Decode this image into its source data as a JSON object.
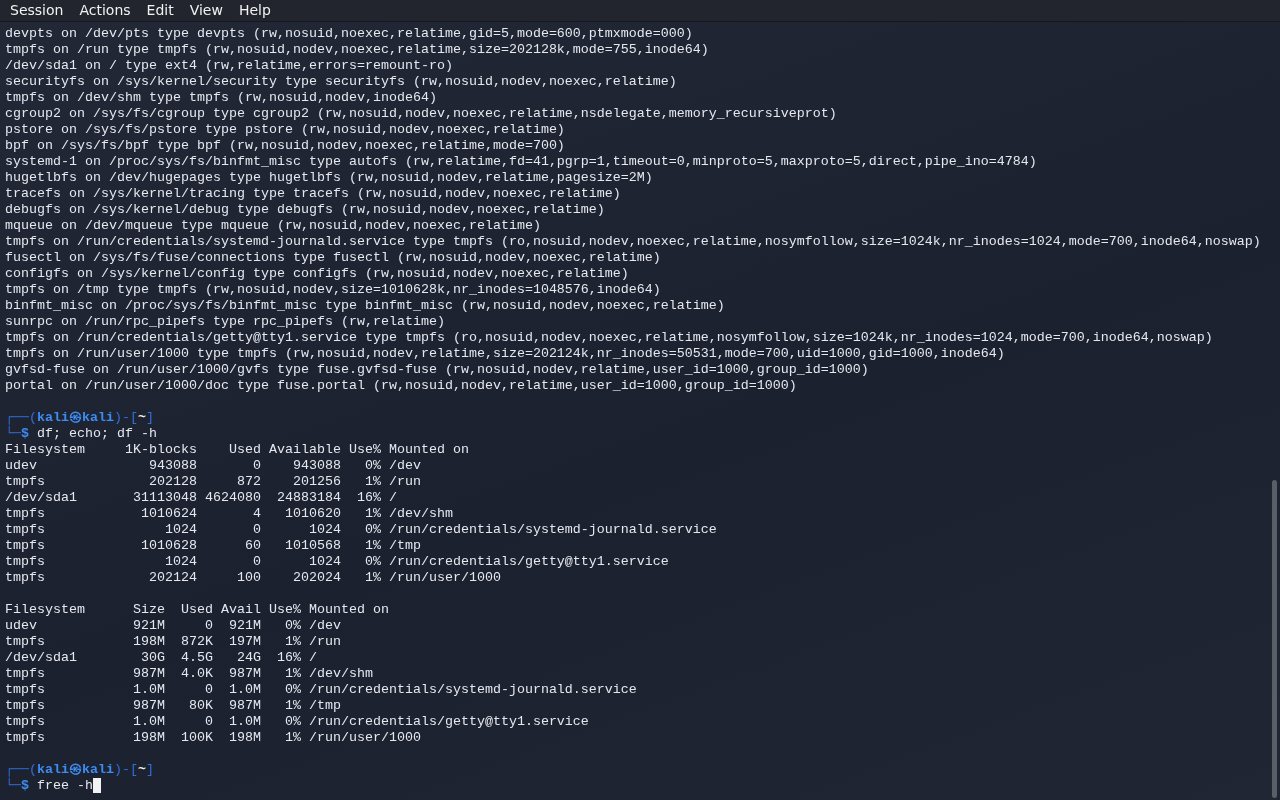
{
  "menu": [
    {
      "label": "Session"
    },
    {
      "label": "Actions"
    },
    {
      "label": "Edit"
    },
    {
      "label": "View"
    },
    {
      "label": "Help"
    }
  ],
  "lines": [
    {
      "kind": "output",
      "text": "devpts on /dev/pts type devpts (rw,nosuid,noexec,relatime,gid=5,mode=600,ptmxmode=000)"
    },
    {
      "kind": "output",
      "text": "tmpfs on /run type tmpfs (rw,nosuid,nodev,noexec,relatime,size=202128k,mode=755,inode64)"
    },
    {
      "kind": "output",
      "text": "/dev/sda1 on / type ext4 (rw,relatime,errors=remount-ro)"
    },
    {
      "kind": "output",
      "text": "securityfs on /sys/kernel/security type securityfs (rw,nosuid,nodev,noexec,relatime)"
    },
    {
      "kind": "output",
      "text": "tmpfs on /dev/shm type tmpfs (rw,nosuid,nodev,inode64)"
    },
    {
      "kind": "output",
      "text": "cgroup2 on /sys/fs/cgroup type cgroup2 (rw,nosuid,nodev,noexec,relatime,nsdelegate,memory_recursiveprot)"
    },
    {
      "kind": "output",
      "text": "pstore on /sys/fs/pstore type pstore (rw,nosuid,nodev,noexec,relatime)"
    },
    {
      "kind": "output",
      "text": "bpf on /sys/fs/bpf type bpf (rw,nosuid,nodev,noexec,relatime,mode=700)"
    },
    {
      "kind": "output",
      "text": "systemd-1 on /proc/sys/fs/binfmt_misc type autofs (rw,relatime,fd=41,pgrp=1,timeout=0,minproto=5,maxproto=5,direct,pipe_ino=4784)"
    },
    {
      "kind": "output",
      "text": "hugetlbfs on /dev/hugepages type hugetlbfs (rw,nosuid,nodev,relatime,pagesize=2M)"
    },
    {
      "kind": "output",
      "text": "tracefs on /sys/kernel/tracing type tracefs (rw,nosuid,nodev,noexec,relatime)"
    },
    {
      "kind": "output",
      "text": "debugfs on /sys/kernel/debug type debugfs (rw,nosuid,nodev,noexec,relatime)"
    },
    {
      "kind": "output",
      "text": "mqueue on /dev/mqueue type mqueue (rw,nosuid,nodev,noexec,relatime)"
    },
    {
      "kind": "output",
      "text": "tmpfs on /run/credentials/systemd-journald.service type tmpfs (ro,nosuid,nodev,noexec,relatime,nosymfollow,size=1024k,nr_inodes=1024,mode=700,inode64,noswap)"
    },
    {
      "kind": "output",
      "text": "fusectl on /sys/fs/fuse/connections type fusectl (rw,nosuid,nodev,noexec,relatime)"
    },
    {
      "kind": "output",
      "text": "configfs on /sys/kernel/config type configfs (rw,nosuid,nodev,noexec,relatime)"
    },
    {
      "kind": "output",
      "text": "tmpfs on /tmp type tmpfs (rw,nosuid,nodev,size=1010628k,nr_inodes=1048576,inode64)"
    },
    {
      "kind": "output",
      "text": "binfmt_misc on /proc/sys/fs/binfmt_misc type binfmt_misc (rw,nosuid,nodev,noexec,relatime)"
    },
    {
      "kind": "output",
      "text": "sunrpc on /run/rpc_pipefs type rpc_pipefs (rw,relatime)"
    },
    {
      "kind": "output",
      "text": "tmpfs on /run/credentials/getty@tty1.service type tmpfs (ro,nosuid,nodev,noexec,relatime,nosymfollow,size=1024k,nr_inodes=1024,mode=700,inode64,noswap)"
    },
    {
      "kind": "output",
      "text": "tmpfs on /run/user/1000 type tmpfs (rw,nosuid,nodev,relatime,size=202124k,nr_inodes=50531,mode=700,uid=1000,gid=1000,inode64)"
    },
    {
      "kind": "output",
      "text": "gvfsd-fuse on /run/user/1000/gvfs type fuse.gvfsd-fuse (rw,nosuid,nodev,relatime,user_id=1000,group_id=1000)"
    },
    {
      "kind": "output",
      "text": "portal on /run/user/1000/doc type fuse.portal (rw,nosuid,nodev,relatime,user_id=1000,group_id=1000)"
    },
    {
      "kind": "blank"
    },
    {
      "kind": "prompt",
      "corner_top": "┌──(",
      "user": "kali",
      "at": "㉿",
      "host": "kali",
      "mid": ")-[",
      "dir": "~",
      "end": "]",
      "corner_bottom": "└─",
      "symbol": "$",
      "command": "df; echo; df -h",
      "cursor": false
    },
    {
      "kind": "output",
      "text": "Filesystem     1K-blocks    Used Available Use% Mounted on"
    },
    {
      "kind": "output",
      "text": "udev              943088       0    943088   0% /dev"
    },
    {
      "kind": "output",
      "text": "tmpfs             202128     872    201256   1% /run"
    },
    {
      "kind": "output",
      "text": "/dev/sda1       31113048 4624080  24883184  16% /"
    },
    {
      "kind": "output",
      "text": "tmpfs            1010624       4   1010620   1% /dev/shm"
    },
    {
      "kind": "output",
      "text": "tmpfs               1024       0      1024   0% /run/credentials/systemd-journald.service"
    },
    {
      "kind": "output",
      "text": "tmpfs            1010628      60   1010568   1% /tmp"
    },
    {
      "kind": "output",
      "text": "tmpfs               1024       0      1024   0% /run/credentials/getty@tty1.service"
    },
    {
      "kind": "output",
      "text": "tmpfs             202124     100    202024   1% /run/user/1000"
    },
    {
      "kind": "blank"
    },
    {
      "kind": "output",
      "text": "Filesystem      Size  Used Avail Use% Mounted on"
    },
    {
      "kind": "output",
      "text": "udev            921M     0  921M   0% /dev"
    },
    {
      "kind": "output",
      "text": "tmpfs           198M  872K  197M   1% /run"
    },
    {
      "kind": "output",
      "text": "/dev/sda1        30G  4.5G   24G  16% /"
    },
    {
      "kind": "output",
      "text": "tmpfs           987M  4.0K  987M   1% /dev/shm"
    },
    {
      "kind": "output",
      "text": "tmpfs           1.0M     0  1.0M   0% /run/credentials/systemd-journald.service"
    },
    {
      "kind": "output",
      "text": "tmpfs           987M   80K  987M   1% /tmp"
    },
    {
      "kind": "output",
      "text": "tmpfs           1.0M     0  1.0M   0% /run/credentials/getty@tty1.service"
    },
    {
      "kind": "output",
      "text": "tmpfs           198M  100K  198M   1% /run/user/1000"
    },
    {
      "kind": "blank"
    },
    {
      "kind": "prompt",
      "corner_top": "┌──(",
      "user": "kali",
      "at": "㉿",
      "host": "kali",
      "mid": ")-[",
      "dir": "~",
      "end": "]",
      "corner_bottom": "└─",
      "symbol": "$",
      "command": "free -h",
      "cursor": true
    }
  ]
}
